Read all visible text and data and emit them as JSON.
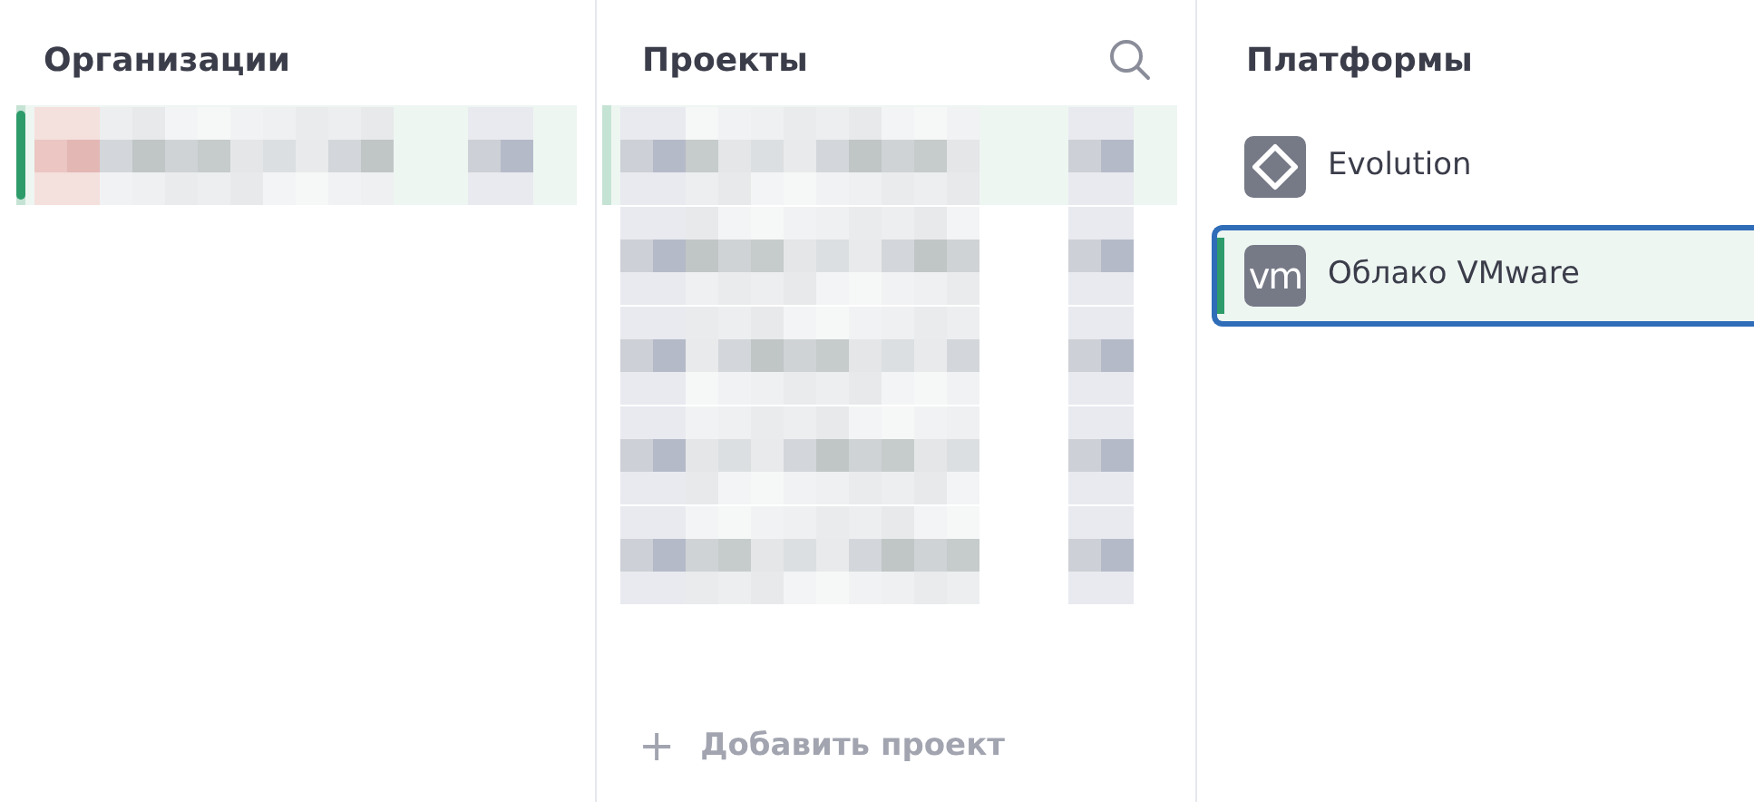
{
  "organizations": {
    "title": "Организации",
    "items": [
      {
        "kind": "redacted",
        "selected": true
      }
    ]
  },
  "projects": {
    "title": "Проекты",
    "items": [
      {
        "kind": "redacted",
        "selected": true
      },
      {
        "kind": "redacted",
        "selected": false
      },
      {
        "kind": "redacted",
        "selected": false
      },
      {
        "kind": "redacted",
        "selected": false
      },
      {
        "kind": "redacted",
        "selected": false
      }
    ],
    "add_button": {
      "icon": "+",
      "label": "Добавить проект"
    }
  },
  "platforms": {
    "title": "Платформы",
    "items": [
      {
        "kind": "diamond",
        "label": "Evolution",
        "selected": false
      },
      {
        "kind": "monogram",
        "monogram": "vm",
        "label": "Облако VMware",
        "selected": true
      }
    ]
  }
}
